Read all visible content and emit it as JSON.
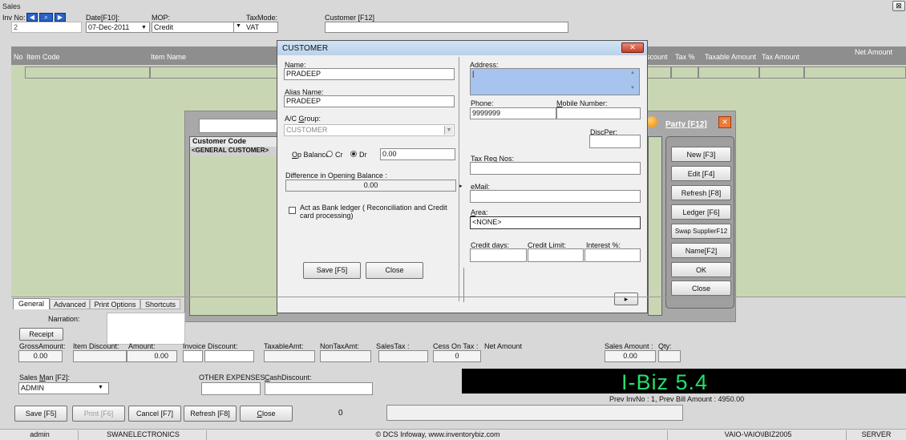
{
  "window": {
    "title": "Sales",
    "close_glyph": "⊠"
  },
  "header": {
    "inv_no_label": "Inv No:",
    "inv_no_value": "2",
    "date_label": "Date[F10]:",
    "date_value": "07-Dec-2011",
    "mop_label": "MOP:",
    "mop_value": "Credit",
    "taxmode_label": "TaxMode:",
    "taxmode_value": "VAT",
    "customer_label": "Customer [F12]"
  },
  "grid": {
    "columns_left": [
      "No",
      "Item Code",
      "Item Name"
    ],
    "columns_right": [
      "scount",
      "Tax %",
      "Taxable Amount",
      "Tax Amount",
      "Net Amount"
    ]
  },
  "customer_dialog": {
    "title": "CUSTOMER",
    "close_glyph": "✕",
    "name_label": "Name:",
    "name_value": "PRADEEP",
    "alias_label": "Alias Name:",
    "alias_value": "PRADEEP",
    "group_label": "A/C Group:",
    "group_value": "CUSTOMER",
    "op_balance_label": "Op Balance:",
    "cr_label": "Cr",
    "dr_label": "Dr",
    "op_balance_value": "0.00",
    "diff_label": "Difference in Opening Balance :",
    "diff_value": "0.00",
    "bank_ledger_label": "Act as Bank ledger ( Reconciliation and Credit card processing)",
    "save_button": "Save [F5]",
    "close_button": "Close",
    "address_label": "Address:",
    "address_value": "|",
    "phone_label": "Phone:",
    "phone_value": "9999999",
    "mobile_label": "Mobile Number:",
    "mobile_value": "",
    "discper_label": "DiscPer:",
    "discper_value": "",
    "taxreg_label": "Tax Reg Nos:",
    "taxreg_value": "",
    "email_label": "eMail:",
    "email_value": "",
    "area_label": "Area:",
    "area_value": "<NONE>",
    "credit_days_label": "Credit days:",
    "credit_limit_label": "Credit Limit:",
    "interest_label": "Interest %:",
    "scroll_arrow": "▸"
  },
  "customer_list": {
    "header": "Customer Code",
    "first_row": "<GENERAL CUSTOMER>"
  },
  "party_panel": {
    "title": "Party [F12]",
    "close_glyph": "✕",
    "buttons": [
      "New [F3]",
      "Edit [F4]",
      "Refresh [F8]",
      "Ledger [F6]",
      "Swap SupplierF12",
      "Name[F2]",
      "OK",
      "Close"
    ]
  },
  "tabs": [
    "General",
    "Advanced",
    "Print Options",
    "Shortcuts"
  ],
  "narration_label": "Narration:",
  "receipt_button": "Receipt",
  "totals": {
    "gross_label": "GrossAmount:",
    "gross_value": "0.00",
    "item_disc_label": "Item Discount:",
    "amount_label": "Amount:",
    "amount_value": "0.00",
    "invoice_disc_label": "Invoice Discount:",
    "taxable_label": "TaxableAmt:",
    "nontax_label": "NonTaxAmt:",
    "salestax_label": "SalesTax :",
    "cess_label": "Cess On Tax :",
    "cess_value": "0",
    "net_label": "Net Amount",
    "sales_amount_label": "Sales Amount :",
    "sales_amount_value": "0.00",
    "qty_label": "Qty:"
  },
  "salesman": {
    "label": "Sales Man [F2]:",
    "value": "ADMIN"
  },
  "other_expenses_label": "OTHER EXPENSES",
  "cash_discount_label": "CashDiscount:",
  "brand": {
    "text": "I-Biz 5.4",
    "color": "#22e06a"
  },
  "prev_info": "Prev InvNo : 1, Prev Bill Amount : 4950.00",
  "bottom_buttons": {
    "save": "Save [F5]",
    "print": "Print [F6]",
    "cancel": "Cancel [F7]",
    "refresh": "Refresh [F8]",
    "close": "Close"
  },
  "bottom_count": "0",
  "statusbar": {
    "user": "admin",
    "company": "SWANELECTRONICS",
    "copyright": "© DCS Infoway, www.inventorybiz.com",
    "machine": "VAIO-VAIO\\IBIZ2005",
    "server": "SERVER"
  }
}
